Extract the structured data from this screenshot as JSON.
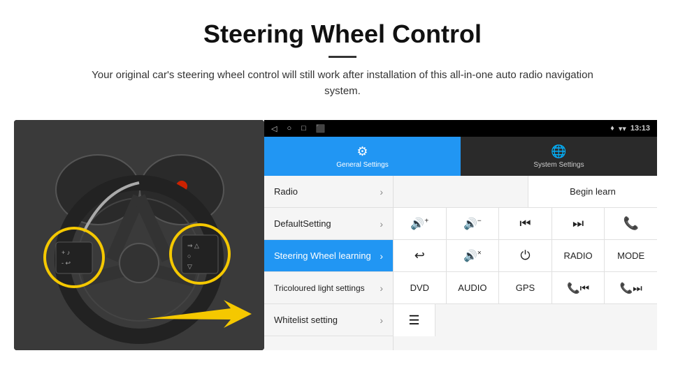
{
  "header": {
    "title": "Steering Wheel Control",
    "subtitle": "Your original car's steering wheel control will still work after installation of this all-in-one auto radio navigation system."
  },
  "status_bar": {
    "back_icon": "◁",
    "home_icon": "○",
    "recent_icon": "□",
    "screenshot_icon": "⬛",
    "signal_icon": "▾",
    "wifi_icon": "▾",
    "time": "13:13"
  },
  "tabs": [
    {
      "label": "General Settings",
      "icon": "⚙",
      "active": true
    },
    {
      "label": "System Settings",
      "icon": "🌐",
      "active": false
    }
  ],
  "menu": [
    {
      "label": "Radio",
      "active": false
    },
    {
      "label": "DefaultSetting",
      "active": false
    },
    {
      "label": "Steering Wheel learning",
      "active": true
    },
    {
      "label": "Tricoloured light settings",
      "active": false
    },
    {
      "label": "Whitelist setting",
      "active": false
    }
  ],
  "controls": {
    "begin_learn": "Begin learn",
    "row1": [
      "🔊+",
      "🔊−",
      "⏮",
      "⏭",
      "📞"
    ],
    "row1_labels": [
      "vol_up",
      "vol_down",
      "prev",
      "next",
      "phone"
    ],
    "row2": [
      "↩",
      "🔊×",
      "⏻",
      "RADIO",
      "MODE"
    ],
    "row3": [
      "DVD",
      "AUDIO",
      "GPS",
      "📞⏮",
      "📞⏭"
    ],
    "row4_icon": "≡"
  }
}
